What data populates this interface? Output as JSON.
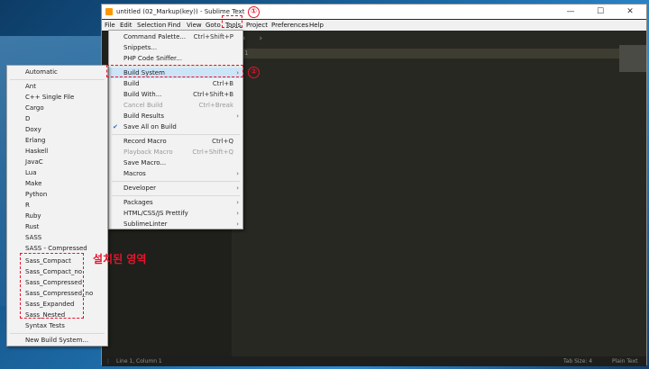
{
  "window": {
    "title": "untitled (02_Markup(key)) - Sublime Text",
    "controls": [
      "—",
      "☐",
      "✕"
    ]
  },
  "menubar": [
    "File",
    "Edit",
    "Selection",
    "Find",
    "View",
    "Goto",
    "Tools",
    "Project",
    "Preferences",
    "Help"
  ],
  "editor": {
    "line_number": "1",
    "tab_arrows": "‹ ›"
  },
  "status": {
    "position": "Line 1, Column 1",
    "tab_size": "Tab Size: 4",
    "syntax": "Plain Text"
  },
  "tools_menu": [
    {
      "label": "Command Palette...",
      "shortcut": "Ctrl+Shift+P"
    },
    {
      "label": "Snippets..."
    },
    {
      "label": "PHP Code Sniffer..."
    },
    {
      "label": "Build System",
      "arrow": "›"
    },
    {
      "label": "Build",
      "shortcut": "Ctrl+B"
    },
    {
      "label": "Build With...",
      "shortcut": "Ctrl+Shift+B"
    },
    {
      "label": "Cancel Build",
      "shortcut": "Ctrl+Break"
    },
    {
      "label": "Build Results",
      "arrow": "›"
    },
    {
      "label": "Save All on Build",
      "check": "✔"
    },
    {
      "label": "Record Macro",
      "shortcut": "Ctrl+Q"
    },
    {
      "label": "Playback Macro",
      "shortcut": "Ctrl+Shift+Q"
    },
    {
      "label": "Save Macro..."
    },
    {
      "label": "Macros",
      "arrow": "›"
    },
    {
      "label": "Developer",
      "arrow": "›"
    },
    {
      "label": "Packages",
      "arrow": "›"
    },
    {
      "label": "HTML/CSS/JS Prettify",
      "arrow": "›"
    },
    {
      "label": "SublimeLinter",
      "arrow": "›"
    }
  ],
  "build_system_menu": [
    "Automatic",
    "Ant",
    "C++ Single File",
    "Cargo",
    "D",
    "Doxy",
    "Erlang",
    "Haskell",
    "JavaC",
    "Lua",
    "Make",
    "Python",
    "R",
    "Ruby",
    "Rust",
    "SASS",
    "SASS - Compressed",
    "Sass_Compact",
    "Sass_Compact_no",
    "Sass_Compressed",
    "Sass_Compressed_no",
    "Sass_Expanded",
    "Sass_Nested",
    "Syntax Tests",
    "New Build System..."
  ],
  "annotations": {
    "marker_1": "①",
    "marker_2": "②",
    "installed_area_label": "설치된 영역"
  },
  "colors": {
    "annotation": "#e8142c",
    "highlight": "#cce4f7",
    "editor_bg": "#272822"
  }
}
